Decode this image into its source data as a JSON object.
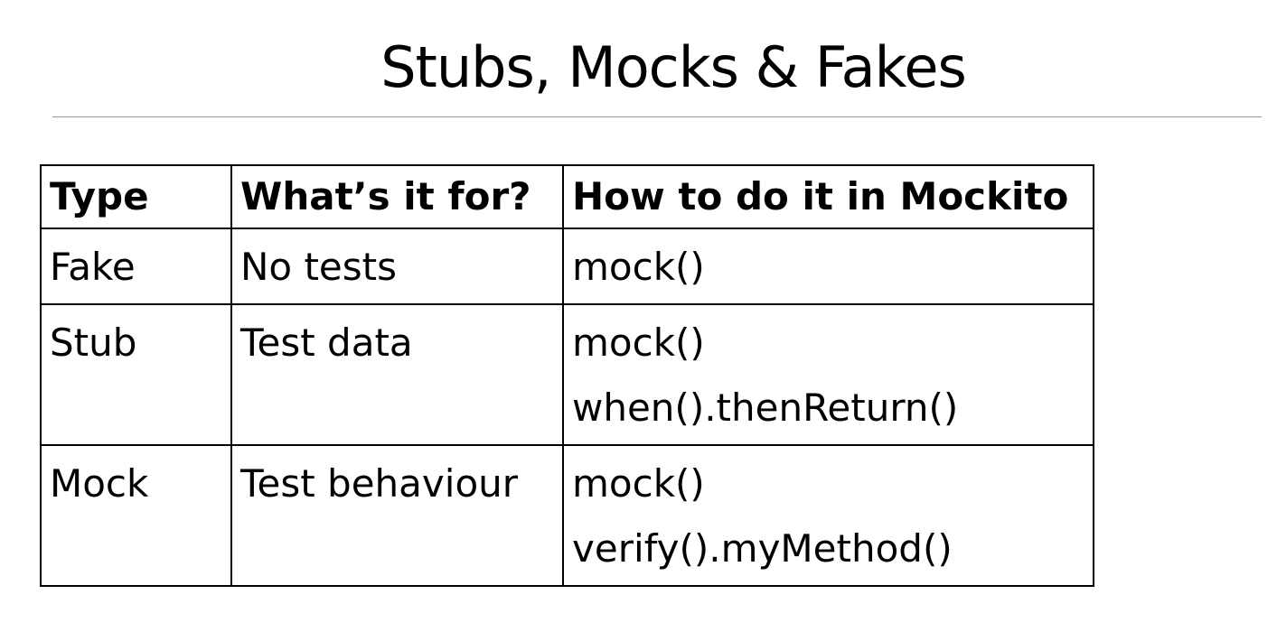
{
  "title": "Stubs, Mocks & Fakes",
  "table": {
    "headers": [
      "Type",
      "What’s it for?",
      "How to do it in Mockito"
    ],
    "rows": [
      {
        "type": "Fake",
        "purpose": "No tests",
        "how": [
          "mock()"
        ]
      },
      {
        "type": "Stub",
        "purpose": "Test data",
        "how": [
          "mock()",
          "when().thenReturn()"
        ]
      },
      {
        "type": "Mock",
        "purpose": "Test behaviour",
        "how": [
          "mock()",
          "verify().myMethod()"
        ]
      }
    ]
  }
}
